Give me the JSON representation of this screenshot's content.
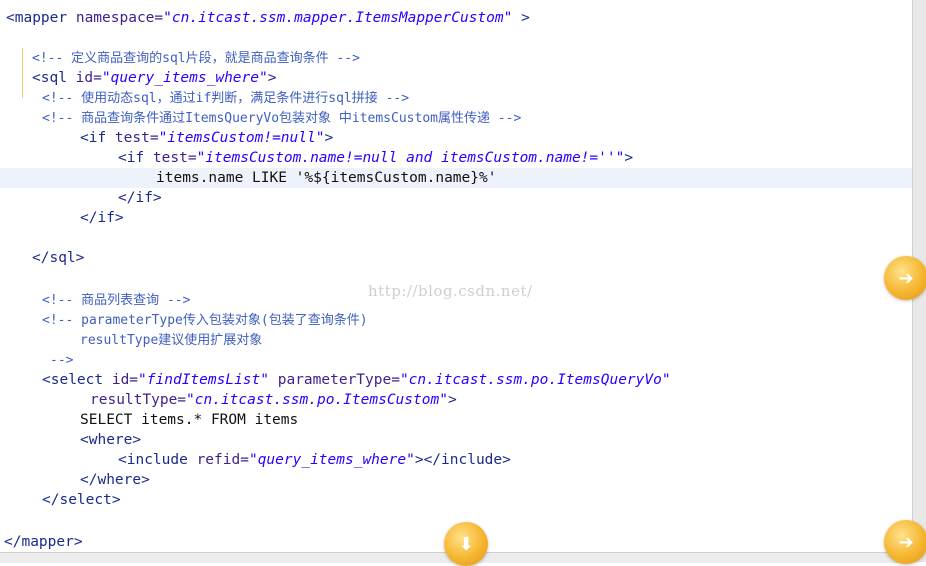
{
  "lines": [
    {
      "segments": [
        {
          "t": "<mapper ",
          "c": "tag"
        },
        {
          "t": "namespace=",
          "c": "attr"
        },
        {
          "t": "\"cn.itcast.ssm.mapper.ItemsMapperCustom\"",
          "c": "val"
        },
        {
          "t": " >",
          "c": "tag"
        }
      ]
    },
    {
      "segments": [
        {
          "t": "<!-- 定义商品查询的sql片段，就是商品查询条件 -->",
          "c": "cmt"
        }
      ]
    },
    {
      "segments": [
        {
          "t": "<sql ",
          "c": "tag"
        },
        {
          "t": "id=",
          "c": "attr"
        },
        {
          "t": "\"query_items_where\"",
          "c": "val"
        },
        {
          "t": ">",
          "c": "tag"
        }
      ]
    },
    {
      "segments": [
        {
          "t": "<!-- 使用动态sql，通过if判断，满足条件进行sql拼接 -->",
          "c": "cmt"
        }
      ]
    },
    {
      "segments": [
        {
          "t": "<!-- 商品查询条件通过ItemsQueryVo包装对象 中itemsCustom属性传递 -->",
          "c": "cmt"
        }
      ]
    },
    {
      "segments": [
        {
          "t": "<if ",
          "c": "tag"
        },
        {
          "t": "test=",
          "c": "attr"
        },
        {
          "t": "\"itemsCustom!=null\"",
          "c": "val"
        },
        {
          "t": ">",
          "c": "tag"
        }
      ]
    },
    {
      "segments": [
        {
          "t": "<if ",
          "c": "tag"
        },
        {
          "t": "test=",
          "c": "attr"
        },
        {
          "t": "\"itemsCustom.name!=null and itemsCustom.name!=''\"",
          "c": "val"
        },
        {
          "t": ">",
          "c": "tag"
        }
      ]
    },
    {
      "segments": [
        {
          "t": "items.name LIKE '%${itemsCustom.name}%'",
          "c": "text"
        }
      ]
    },
    {
      "segments": [
        {
          "t": "</if>",
          "c": "tag"
        }
      ]
    },
    {
      "segments": [
        {
          "t": "</if>",
          "c": "tag"
        }
      ]
    },
    {
      "segments": [
        {
          "t": "</sql>",
          "c": "tag"
        }
      ]
    },
    {
      "segments": [
        {
          "t": "<!-- 商品列表查询 -->",
          "c": "cmt"
        }
      ]
    },
    {
      "segments": [
        {
          "t": "<!-- parameterType传入包装对象(包装了查询条件)",
          "c": "cmt"
        }
      ]
    },
    {
      "segments": [
        {
          "t": "resultType建议使用扩展对象",
          "c": "cmt"
        }
      ]
    },
    {
      "segments": [
        {
          "t": "-->",
          "c": "cmt"
        }
      ]
    },
    {
      "segments": [
        {
          "t": "<select ",
          "c": "tag"
        },
        {
          "t": "id=",
          "c": "attr"
        },
        {
          "t": "\"findItemsList\"",
          "c": "val"
        },
        {
          "t": " parameterType=",
          "c": "attr"
        },
        {
          "t": "\"cn.itcast.ssm.po.ItemsQueryVo\"",
          "c": "val"
        }
      ]
    },
    {
      "segments": [
        {
          "t": "resultType=",
          "c": "attr"
        },
        {
          "t": "\"cn.itcast.ssm.po.ItemsCustom\"",
          "c": "val"
        },
        {
          "t": ">",
          "c": "tag"
        }
      ]
    },
    {
      "segments": [
        {
          "t": "SELECT items.* FROM items",
          "c": "text"
        }
      ]
    },
    {
      "segments": [
        {
          "t": "<where>",
          "c": "tag"
        }
      ]
    },
    {
      "segments": [
        {
          "t": "<include ",
          "c": "tag"
        },
        {
          "t": "refid=",
          "c": "attr"
        },
        {
          "t": "\"query_items_where\"",
          "c": "val"
        },
        {
          "t": "></include>",
          "c": "tag"
        }
      ]
    },
    {
      "segments": [
        {
          "t": "</where>",
          "c": "tag"
        }
      ]
    },
    {
      "segments": [
        {
          "t": "</select>",
          "c": "tag"
        }
      ]
    },
    {
      "segments": [
        {
          "t": "</mapper>",
          "c": "tag"
        }
      ]
    }
  ],
  "watermark": "http://blog.csdn.net/",
  "colors": {
    "tag": "#1a2a8c",
    "attr": "#3f1f8a",
    "value": "#2a00ff",
    "comment": "#3f5fbf",
    "orb": "#f5b52f"
  },
  "icons": [
    "orange-orb-icon",
    "orange-orb-icon",
    "orange-orb-icon"
  ]
}
